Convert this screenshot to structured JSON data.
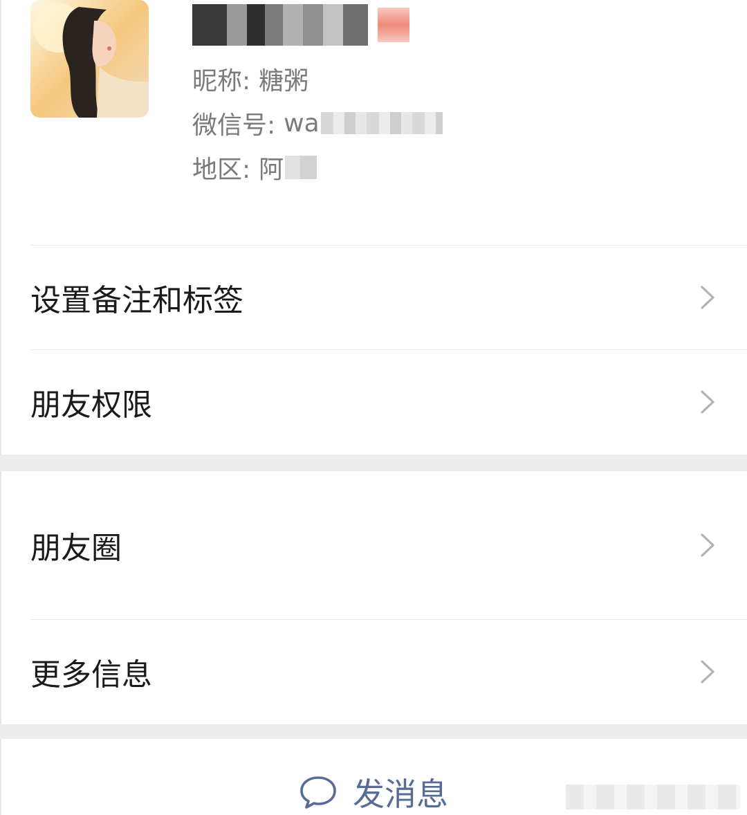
{
  "profile": {
    "avatar_alt": "contact avatar",
    "nickname_label": "昵称:",
    "nickname_value": "糖粥",
    "wechat_id_label": "微信号:",
    "wechat_id_value": "wa",
    "region_label": "地区:",
    "region_value": "阿"
  },
  "menu": {
    "remark_tags": "设置备注和标签",
    "friend_permissions": "朋友权限",
    "moments": "朋友圈",
    "more_info": "更多信息"
  },
  "actions": {
    "send_message": "发消息"
  },
  "colors": {
    "link_blue": "#576b95",
    "separator_band": "#ededed",
    "secondary_text": "#7a7a7a"
  }
}
